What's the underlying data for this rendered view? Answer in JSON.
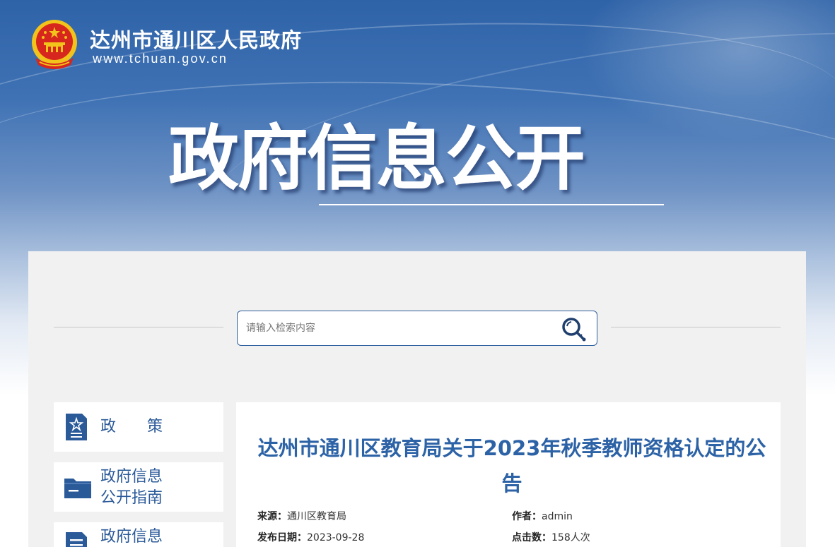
{
  "header": {
    "site_title": "达州市通川区人民政府",
    "site_url": "www.tchuan.gov.cn",
    "hero_title": "政府信息公开",
    "emblem_icon": "national-emblem-icon"
  },
  "search": {
    "placeholder": "请输入检索内容",
    "icon": "search-icon"
  },
  "sidebar": {
    "items": [
      {
        "label_line1": "政　　策",
        "label_line2": "",
        "icon": "policy-document-icon"
      },
      {
        "label_line1": "政府信息",
        "label_line2": "公开指南",
        "icon": "folder-icon"
      },
      {
        "label_line1": "政府信息",
        "label_line2": "",
        "icon": "list-document-icon"
      }
    ]
  },
  "article": {
    "title": "达州市通川区教育局关于2023年秋季教师资格认定的公告",
    "source_label": "来源：",
    "source_value": "通川区教育局",
    "author_label": "作者：",
    "author_value": "admin",
    "date_label": "发布日期：",
    "date_value": "2023-09-28",
    "clicks_label": "点击数：",
    "clicks_value": "158人次"
  },
  "colors": {
    "primary_blue": "#2c62a6",
    "banner_top": "#2f63a8",
    "panel_bg": "#f1f1f1",
    "emblem_red": "#d7261e",
    "emblem_gold": "#f2c31a"
  }
}
